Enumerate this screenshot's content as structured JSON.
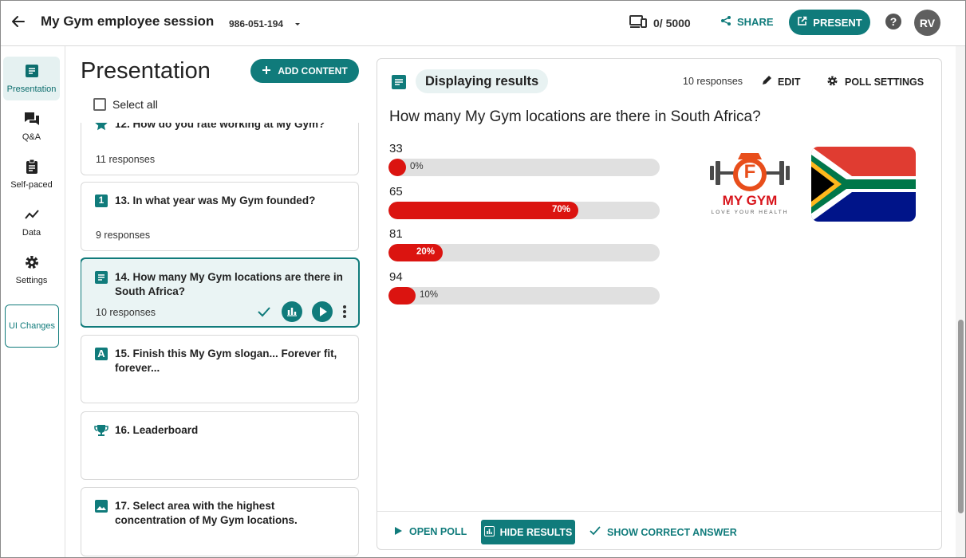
{
  "header": {
    "title": "My Gym employee session",
    "code": "986-051-194",
    "devices": "0/ 5000",
    "share_label": "SHARE",
    "present_label": "PRESENT",
    "help": "?",
    "avatar_initials": "RV"
  },
  "nav": {
    "items": [
      {
        "label": "Presentation",
        "icon": "presentation-icon"
      },
      {
        "label": "Q&A",
        "icon": "chat-icon"
      },
      {
        "label": "Self-paced",
        "icon": "clipboard-icon"
      },
      {
        "label": "Data",
        "icon": "trending-icon"
      },
      {
        "label": "Settings",
        "icon": "gear-icon"
      }
    ],
    "ui_changes": "UI Changes"
  },
  "content": {
    "title": "Presentation",
    "add_label": "ADD CONTENT",
    "select_all": "Select all"
  },
  "cards": [
    {
      "title": "12. How do you rate working at My Gym?",
      "responses": "11 responses",
      "icon": "star-icon"
    },
    {
      "title": "13. In what year was My Gym founded?",
      "responses": "9 responses",
      "icon": "number-icon",
      "icon_text": "1"
    },
    {
      "title": "14. How many My Gym locations are there in South Africa?",
      "responses": "10 responses",
      "icon": "text-list-icon"
    },
    {
      "title": "15. Finish this My Gym slogan... Forever fit, forever...",
      "icon": "letter-icon",
      "icon_text": "A"
    },
    {
      "title": "16. Leaderboard",
      "icon": "trophy-icon"
    },
    {
      "title": "17. Select area with the highest concentration of My Gym locations.",
      "icon": "image-icon"
    }
  ],
  "panel": {
    "status": "Displaying results",
    "responses": "10 responses",
    "edit_label": "EDIT",
    "settings_label": "POLL SETTINGS",
    "question": "How many My Gym locations are there in South Africa?",
    "logo_text": "MY GYM",
    "logo_letter": "F",
    "logo_tagline": "LOVE YOUR HEALTH",
    "footer": {
      "open_poll": "OPEN POLL",
      "hide_results": "HIDE RESULTS",
      "show_correct": "SHOW CORRECT ANSWER"
    }
  },
  "results": [
    {
      "label": "33",
      "percent": 0,
      "percent_text": "0%"
    },
    {
      "label": "65",
      "percent": 70,
      "percent_text": "70%"
    },
    {
      "label": "81",
      "percent": 20,
      "percent_text": "20%"
    },
    {
      "label": "94",
      "percent": 10,
      "percent_text": "10%"
    }
  ],
  "colors": {
    "accent": "#107b7b",
    "bar": "#db1410",
    "track": "#e0e0e0"
  }
}
